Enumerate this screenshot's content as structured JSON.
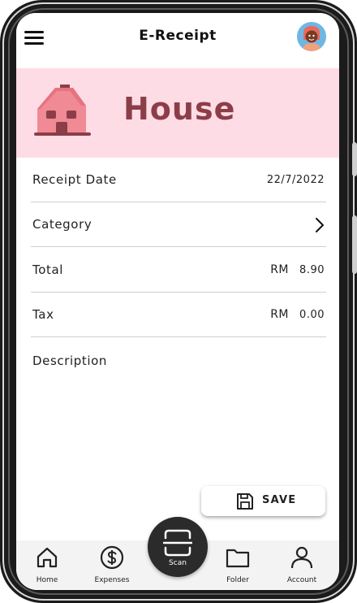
{
  "header": {
    "title": "E-Receipt",
    "menu_icon": "hamburger-icon",
    "avatar_icon": "avatar-icon"
  },
  "banner": {
    "title": "House",
    "icon": "house-icon",
    "background": "#fedce6",
    "title_color": "#8c3e48"
  },
  "fields": {
    "receipt_date": {
      "label": "Receipt Date",
      "value": "22/7/2022"
    },
    "category": {
      "label": "Category",
      "icon": "chevron-right-icon"
    },
    "total": {
      "label": "Total",
      "currency": "RM",
      "value": "8.90"
    },
    "tax": {
      "label": "Tax",
      "currency": "RM",
      "value": "0.00"
    },
    "description": {
      "label": "Description",
      "value": ""
    }
  },
  "save_button": {
    "label": "SAVE",
    "icon": "floppy-disk-icon"
  },
  "bottom_nav": {
    "home": {
      "label": "Home",
      "icon": "home-icon"
    },
    "expenses": {
      "label": "Expenses",
      "icon": "dollar-icon"
    },
    "scan": {
      "label": "Scan",
      "icon": "scan-icon"
    },
    "folder": {
      "label": "Folder",
      "icon": "folder-icon"
    },
    "account": {
      "label": "Account",
      "icon": "person-icon"
    }
  }
}
